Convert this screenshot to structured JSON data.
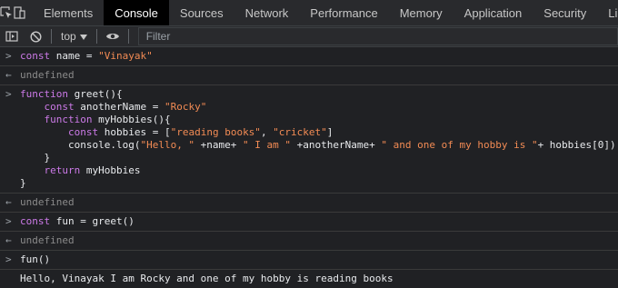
{
  "tabs": [
    "Elements",
    "Console",
    "Sources",
    "Network",
    "Performance",
    "Memory",
    "Application",
    "Security",
    "Li"
  ],
  "active_tab": "Console",
  "toolbar": {
    "context": "top",
    "filter_placeholder": "Filter"
  },
  "console": {
    "entries": [
      {
        "type": "input",
        "lines": [
          [
            [
              "kw",
              "const"
            ],
            [
              "plain",
              " name = "
            ],
            [
              "str",
              "\"Vinayak\""
            ]
          ]
        ]
      },
      {
        "type": "result",
        "text": "undefined"
      },
      {
        "type": "input",
        "lines": [
          [
            [
              "kw",
              "function"
            ],
            [
              "plain",
              " greet(){"
            ]
          ],
          [
            [
              "plain",
              "    "
            ],
            [
              "kw",
              "const"
            ],
            [
              "plain",
              " anotherName = "
            ],
            [
              "str",
              "\"Rocky\""
            ]
          ],
          [
            [
              "plain",
              "    "
            ],
            [
              "kw",
              "function"
            ],
            [
              "plain",
              " myHobbies(){"
            ]
          ],
          [
            [
              "plain",
              "        "
            ],
            [
              "kw",
              "const"
            ],
            [
              "plain",
              " hobbies = ["
            ],
            [
              "str",
              "\"reading books\""
            ],
            [
              "plain",
              ", "
            ],
            [
              "str",
              "\"cricket\""
            ],
            [
              "plain",
              "]"
            ]
          ],
          [
            [
              "plain",
              "        console.log("
            ],
            [
              "str",
              "\"Hello, \""
            ],
            [
              "plain",
              " +name+ "
            ],
            [
              "str",
              "\" I am \""
            ],
            [
              "plain",
              " +anotherName+ "
            ],
            [
              "str",
              "\" and one of my hobby is \""
            ],
            [
              "plain",
              "+ hobbies[0])"
            ]
          ],
          [
            [
              "plain",
              "    }"
            ]
          ],
          [
            [
              "plain",
              "    "
            ],
            [
              "kw",
              "return"
            ],
            [
              "plain",
              " myHobbies"
            ]
          ],
          [
            [
              "plain",
              "}"
            ]
          ]
        ]
      },
      {
        "type": "result",
        "text": "undefined"
      },
      {
        "type": "input",
        "lines": [
          [
            [
              "kw",
              "const"
            ],
            [
              "plain",
              " fun = greet()"
            ]
          ]
        ]
      },
      {
        "type": "result",
        "text": "undefined"
      },
      {
        "type": "input",
        "lines": [
          [
            [
              "plain",
              "fun()"
            ]
          ]
        ]
      },
      {
        "type": "log",
        "text": "Hello, Vinayak I am Rocky and one of my hobby is reading books"
      }
    ]
  },
  "icons": {
    "inspect": "inspect-icon",
    "device": "device-toggle-icon",
    "sidebar": "sidebar-toggle-icon",
    "clear": "clear-console-icon",
    "eye": "live-expression-icon",
    "dropdown": "chevron-down-icon",
    "prompt": "prompt-chevron-icon",
    "result": "result-arrow-icon"
  }
}
